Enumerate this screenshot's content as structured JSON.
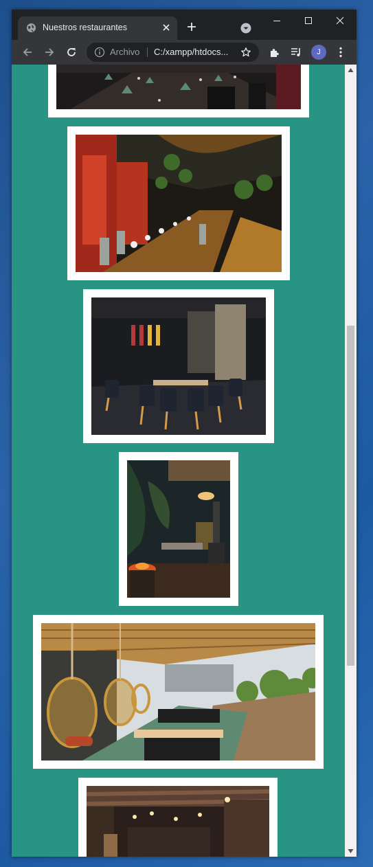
{
  "browser": {
    "tab_title": "Nuestros restaurantes",
    "address_scheme_label": "Archivo",
    "address_url": "C:/xampp/htdocs...",
    "profile_initial": "J"
  },
  "icons": {
    "favicon": "globe-icon",
    "tab_close": "close-icon",
    "new_tab": "plus-icon",
    "tab_search": "chevron-down-icon",
    "minimize": "minimize-icon",
    "maximize": "maximize-icon",
    "close_window": "close-icon",
    "back": "arrow-left-icon",
    "forward": "arrow-right-icon",
    "reload": "reload-icon",
    "site_info": "info-icon",
    "bookmark": "star-icon",
    "extensions": "puzzle-icon",
    "media": "playlist-icon",
    "menu": "kebab-menu-icon"
  },
  "colors": {
    "page_background": "#279484",
    "frame": "#ffffff",
    "browser_chrome": "#35363a",
    "title_bar": "#202124"
  },
  "gallery": {
    "images": [
      {
        "subject": "dark dining room with folded green napkins"
      },
      {
        "subject": "restaurant with red panels and long wooden tables"
      },
      {
        "subject": "dark interior with black chairs and wooden legs"
      },
      {
        "subject": "terrace with hanging plants and fire pit"
      },
      {
        "subject": "rooftop terrace with hanging rattan chairs"
      },
      {
        "subject": "industrial interior with copper ducts"
      }
    ]
  }
}
